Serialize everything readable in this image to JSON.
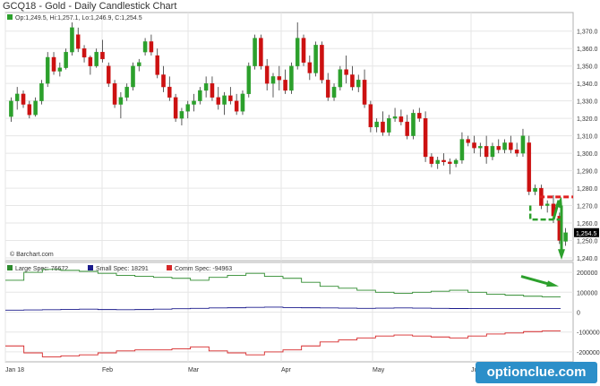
{
  "title": "GCQ18 - Gold - Daily Candlestick Chart",
  "ohlc_label": "Op:1,249.5, Hi:1,257.1, Lo:1,246.9, C:1,254.5",
  "source_label": "© Barchart.com",
  "last_price_label": "1,254.5",
  "watermark": "optionclue.com",
  "colors": {
    "up": "#2ca02c",
    "down": "#cc1111",
    "large": "#2e8b2e",
    "small": "#1a1a8c",
    "comm": "#d62728",
    "annot_red": "#e02020",
    "annot_green": "#2ca02c"
  },
  "chart_data": {
    "type": "candlestick",
    "title": "GCQ18 - Gold - Daily Candlestick Chart",
    "x_ticks": [
      "Jan 18",
      "Feb",
      "Mar",
      "Apr",
      "May",
      "Jun"
    ],
    "price_axis": {
      "ylim": [
        1240,
        1375
      ],
      "ticks": [
        "1,240.0",
        "1,250.0",
        "1,260.0",
        "1,270.0",
        "1,280.0",
        "1,290.0",
        "1,300.0",
        "1,310.0",
        "1,320.0",
        "1,330.0",
        "1,340.0",
        "1,350.0",
        "1,360.0",
        "1,370.0"
      ]
    },
    "candles": [
      [
        1321,
        1332,
        1318,
        1330
      ],
      [
        1330,
        1338,
        1325,
        1334
      ],
      [
        1334,
        1336,
        1326,
        1328
      ],
      [
        1328,
        1330,
        1320,
        1322
      ],
      [
        1322,
        1332,
        1321,
        1330
      ],
      [
        1330,
        1342,
        1328,
        1340
      ],
      [
        1340,
        1358,
        1338,
        1355
      ],
      [
        1355,
        1358,
        1345,
        1347
      ],
      [
        1347,
        1352,
        1344,
        1349
      ],
      [
        1349,
        1360,
        1348,
        1358
      ],
      [
        1358,
        1375,
        1356,
        1372
      ],
      [
        1368,
        1372,
        1358,
        1360
      ],
      [
        1360,
        1362,
        1352,
        1355
      ],
      [
        1355,
        1356,
        1345,
        1350
      ],
      [
        1350,
        1360,
        1349,
        1358
      ],
      [
        1358,
        1365,
        1352,
        1354
      ],
      [
        1350,
        1352,
        1338,
        1340
      ],
      [
        1340,
        1342,
        1326,
        1328
      ],
      [
        1328,
        1335,
        1320,
        1332
      ],
      [
        1332,
        1340,
        1330,
        1338
      ],
      [
        1338,
        1352,
        1336,
        1350
      ],
      [
        1350,
        1354,
        1347,
        1352
      ],
      [
        1358,
        1366,
        1356,
        1364
      ],
      [
        1364,
        1368,
        1356,
        1358
      ],
      [
        1356,
        1360,
        1343,
        1345
      ],
      [
        1345,
        1350,
        1335,
        1338
      ],
      [
        1338,
        1344,
        1330,
        1332
      ],
      [
        1332,
        1334,
        1318,
        1320
      ],
      [
        1320,
        1326,
        1316,
        1324
      ],
      [
        1324,
        1330,
        1320,
        1328
      ],
      [
        1328,
        1334,
        1324,
        1330
      ],
      [
        1330,
        1338,
        1328,
        1336
      ],
      [
        1336,
        1344,
        1332,
        1340
      ],
      [
        1340,
        1344,
        1330,
        1332
      ],
      [
        1332,
        1338,
        1325,
        1328
      ],
      [
        1328,
        1335,
        1322,
        1333
      ],
      [
        1333,
        1338,
        1328,
        1330
      ],
      [
        1330,
        1334,
        1322,
        1324
      ],
      [
        1324,
        1336,
        1322,
        1334
      ],
      [
        1334,
        1352,
        1332,
        1350
      ],
      [
        1350,
        1368,
        1348,
        1366
      ],
      [
        1366,
        1368,
        1348,
        1350
      ],
      [
        1350,
        1354,
        1336,
        1340
      ],
      [
        1340,
        1346,
        1332,
        1344
      ],
      [
        1344,
        1350,
        1336,
        1342
      ],
      [
        1342,
        1348,
        1334,
        1336
      ],
      [
        1336,
        1352,
        1334,
        1350
      ],
      [
        1350,
        1375,
        1348,
        1366
      ],
      [
        1366,
        1368,
        1350,
        1352
      ],
      [
        1352,
        1356,
        1342,
        1346
      ],
      [
        1346,
        1364,
        1344,
        1362
      ],
      [
        1362,
        1364,
        1340,
        1342
      ],
      [
        1342,
        1346,
        1330,
        1332
      ],
      [
        1332,
        1340,
        1330,
        1338
      ],
      [
        1338,
        1350,
        1336,
        1348
      ],
      [
        1348,
        1356,
        1340,
        1345
      ],
      [
        1345,
        1350,
        1336,
        1338
      ],
      [
        1338,
        1345,
        1335,
        1342
      ],
      [
        1342,
        1348,
        1326,
        1328
      ],
      [
        1328,
        1330,
        1312,
        1315
      ],
      [
        1315,
        1320,
        1312,
        1318
      ],
      [
        1318,
        1324,
        1310,
        1312
      ],
      [
        1312,
        1322,
        1310,
        1320
      ],
      [
        1320,
        1326,
        1318,
        1321
      ],
      [
        1321,
        1325,
        1316,
        1318
      ],
      [
        1318,
        1322,
        1308,
        1310
      ],
      [
        1310,
        1325,
        1308,
        1323
      ],
      [
        1323,
        1326,
        1318,
        1320
      ],
      [
        1320,
        1324,
        1295,
        1298
      ],
      [
        1298,
        1300,
        1292,
        1294
      ],
      [
        1294,
        1298,
        1291,
        1296
      ],
      [
        1296,
        1300,
        1293,
        1295
      ],
      [
        1295,
        1297,
        1288,
        1294
      ],
      [
        1294,
        1297,
        1292,
        1296
      ],
      [
        1296,
        1312,
        1294,
        1308
      ],
      [
        1308,
        1310,
        1304,
        1306
      ],
      [
        1306,
        1310,
        1300,
        1303
      ],
      [
        1303,
        1306,
        1298,
        1304
      ],
      [
        1304,
        1310,
        1294,
        1298
      ],
      [
        1298,
        1306,
        1296,
        1304
      ],
      [
        1304,
        1308,
        1300,
        1302
      ],
      [
        1302,
        1308,
        1300,
        1306
      ],
      [
        1306,
        1310,
        1300,
        1302
      ],
      [
        1302,
        1306,
        1298,
        1300
      ],
      [
        1300,
        1314,
        1298,
        1310
      ],
      [
        1306,
        1310,
        1276,
        1278
      ],
      [
        1278,
        1282,
        1276,
        1280
      ],
      [
        1280,
        1282,
        1268,
        1270
      ],
      [
        1270,
        1273,
        1266,
        1271
      ],
      [
        1271,
        1276,
        1260,
        1264
      ],
      [
        1264,
        1266,
        1248,
        1250
      ],
      [
        1249.5,
        1257.1,
        1246.9,
        1254.5
      ]
    ],
    "cot_axis": {
      "ylim": [
        -250000,
        250000
      ],
      "ticks": [
        "200000",
        "100000",
        "0",
        "-100000",
        "-200000"
      ]
    },
    "series": [
      {
        "name": "Large Spec",
        "legend": "Large Spec: 76672",
        "values": [
          160000,
          200000,
          215000,
          210000,
          205000,
          195000,
          185000,
          180000,
          175000,
          170000,
          160000,
          175000,
          185000,
          195000,
          180000,
          170000,
          150000,
          130000,
          120000,
          110000,
          100000,
          95000,
          100000,
          105000,
          110000,
          100000,
          90000,
          85000,
          80000,
          76672
        ]
      },
      {
        "name": "Small Spec",
        "legend": "Small Spec: 18291",
        "values": [
          10000,
          11000,
          12000,
          14000,
          15000,
          13000,
          12000,
          13000,
          15000,
          17000,
          19000,
          21000,
          22000,
          24000,
          25000,
          23000,
          22000,
          21000,
          20000,
          19000,
          20000,
          21000,
          20000,
          19000,
          18000,
          18500,
          18291,
          18291,
          18291,
          18291
        ]
      },
      {
        "name": "Comm Spec",
        "legend": "Comm Spec: -94963",
        "values": [
          -170000,
          -205000,
          -225000,
          -220000,
          -215000,
          -205000,
          -195000,
          -190000,
          -190000,
          -185000,
          -175000,
          -195000,
          -205000,
          -215000,
          -200000,
          -190000,
          -170000,
          -150000,
          -140000,
          -130000,
          -120000,
          -115000,
          -120000,
          -125000,
          -130000,
          -120000,
          -110000,
          -105000,
          -98000,
          -94963
        ]
      }
    ]
  }
}
